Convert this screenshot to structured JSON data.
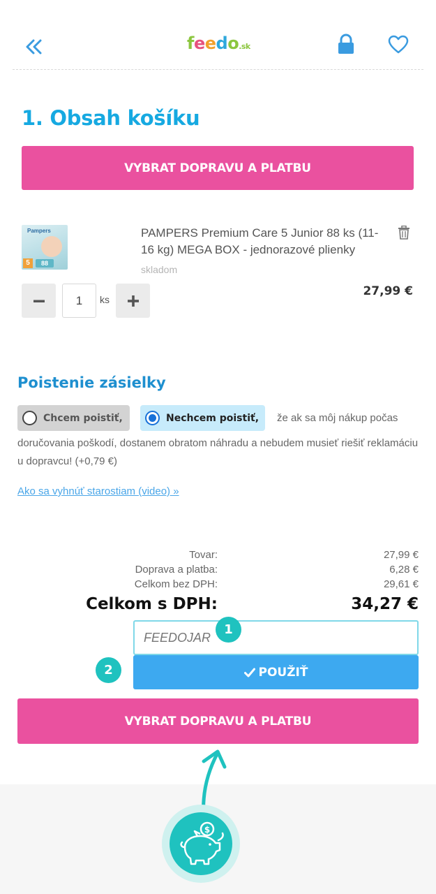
{
  "header": {
    "logo_main": "feedo",
    "logo_suffix": ".sk",
    "icons": [
      "double-chevron-left-icon",
      "lock-icon",
      "heart-icon"
    ],
    "accent_color": "#16a9e1"
  },
  "page_title": "1. Obsah košíku",
  "primary_cta": "VYBRAT DOPRAVU A PLATBU",
  "product": {
    "name": "PAMPERS Premium Care 5 Junior 88 ks (11-16 kg) MEGA BOX - jednorazové plienky",
    "stock": "skladom",
    "quantity": "1",
    "unit": "ks",
    "price": "27,99 €",
    "image_brand": "Pampers",
    "image_size": "5",
    "image_count": "88"
  },
  "insurance": {
    "title": "Poistenie zásielky",
    "option_yes": "Chcem poistiť,",
    "option_no": "Nechcem poistiť,",
    "text_inline": "že ak sa môj nákup počas",
    "text_rest": "doručovania poškodí, dostanem obratom náhradu a nebudem musieť riešiť reklamáciu u dopravcu! (+0,79 €)",
    "link": "Ako sa vyhnúť starostiam (video) »"
  },
  "summary": {
    "goods_label": "Tovar:",
    "goods_value": "27,99 €",
    "shipping_label": "Doprava a platba:",
    "shipping_value": "6,28 €",
    "net_label": "Celkom bez DPH:",
    "net_value": "29,61 €",
    "total_label": "Celkom s DPH:",
    "total_value": "34,27 €"
  },
  "coupon": {
    "placeholder": "FEEDOJAR",
    "apply_label": "POUŽIŤ"
  },
  "badges": {
    "one": "1",
    "two": "2"
  },
  "colors": {
    "pink": "#ea519f",
    "blue_button": "#3da9f0",
    "teal": "#1fc2bf"
  }
}
